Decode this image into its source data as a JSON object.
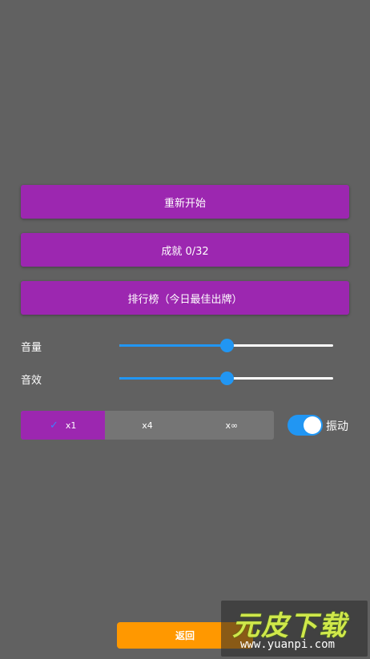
{
  "menu": {
    "restart_label": "重新开始",
    "achievements_label": "成就 0/32",
    "leaderboard_label": "排行榜（今日最佳出牌）"
  },
  "audio": {
    "music_label": "音量",
    "music_level": 0.5,
    "sfx_label": "音效",
    "sfx_level": 0.5
  },
  "speed": {
    "options": [
      "x1",
      "x4",
      "x∞"
    ],
    "selected": "x1"
  },
  "vibration": {
    "label": "振动",
    "enabled": true
  },
  "back_label": "返回",
  "watermark": {
    "title": "元皮下载",
    "url": "www.yuanpi.com"
  },
  "colors": {
    "background": "#616161",
    "menu_button": "#9c27b0",
    "accent": "#2196f3",
    "back_button": "#ff9800"
  },
  "icons": {
    "check": "check-icon"
  }
}
